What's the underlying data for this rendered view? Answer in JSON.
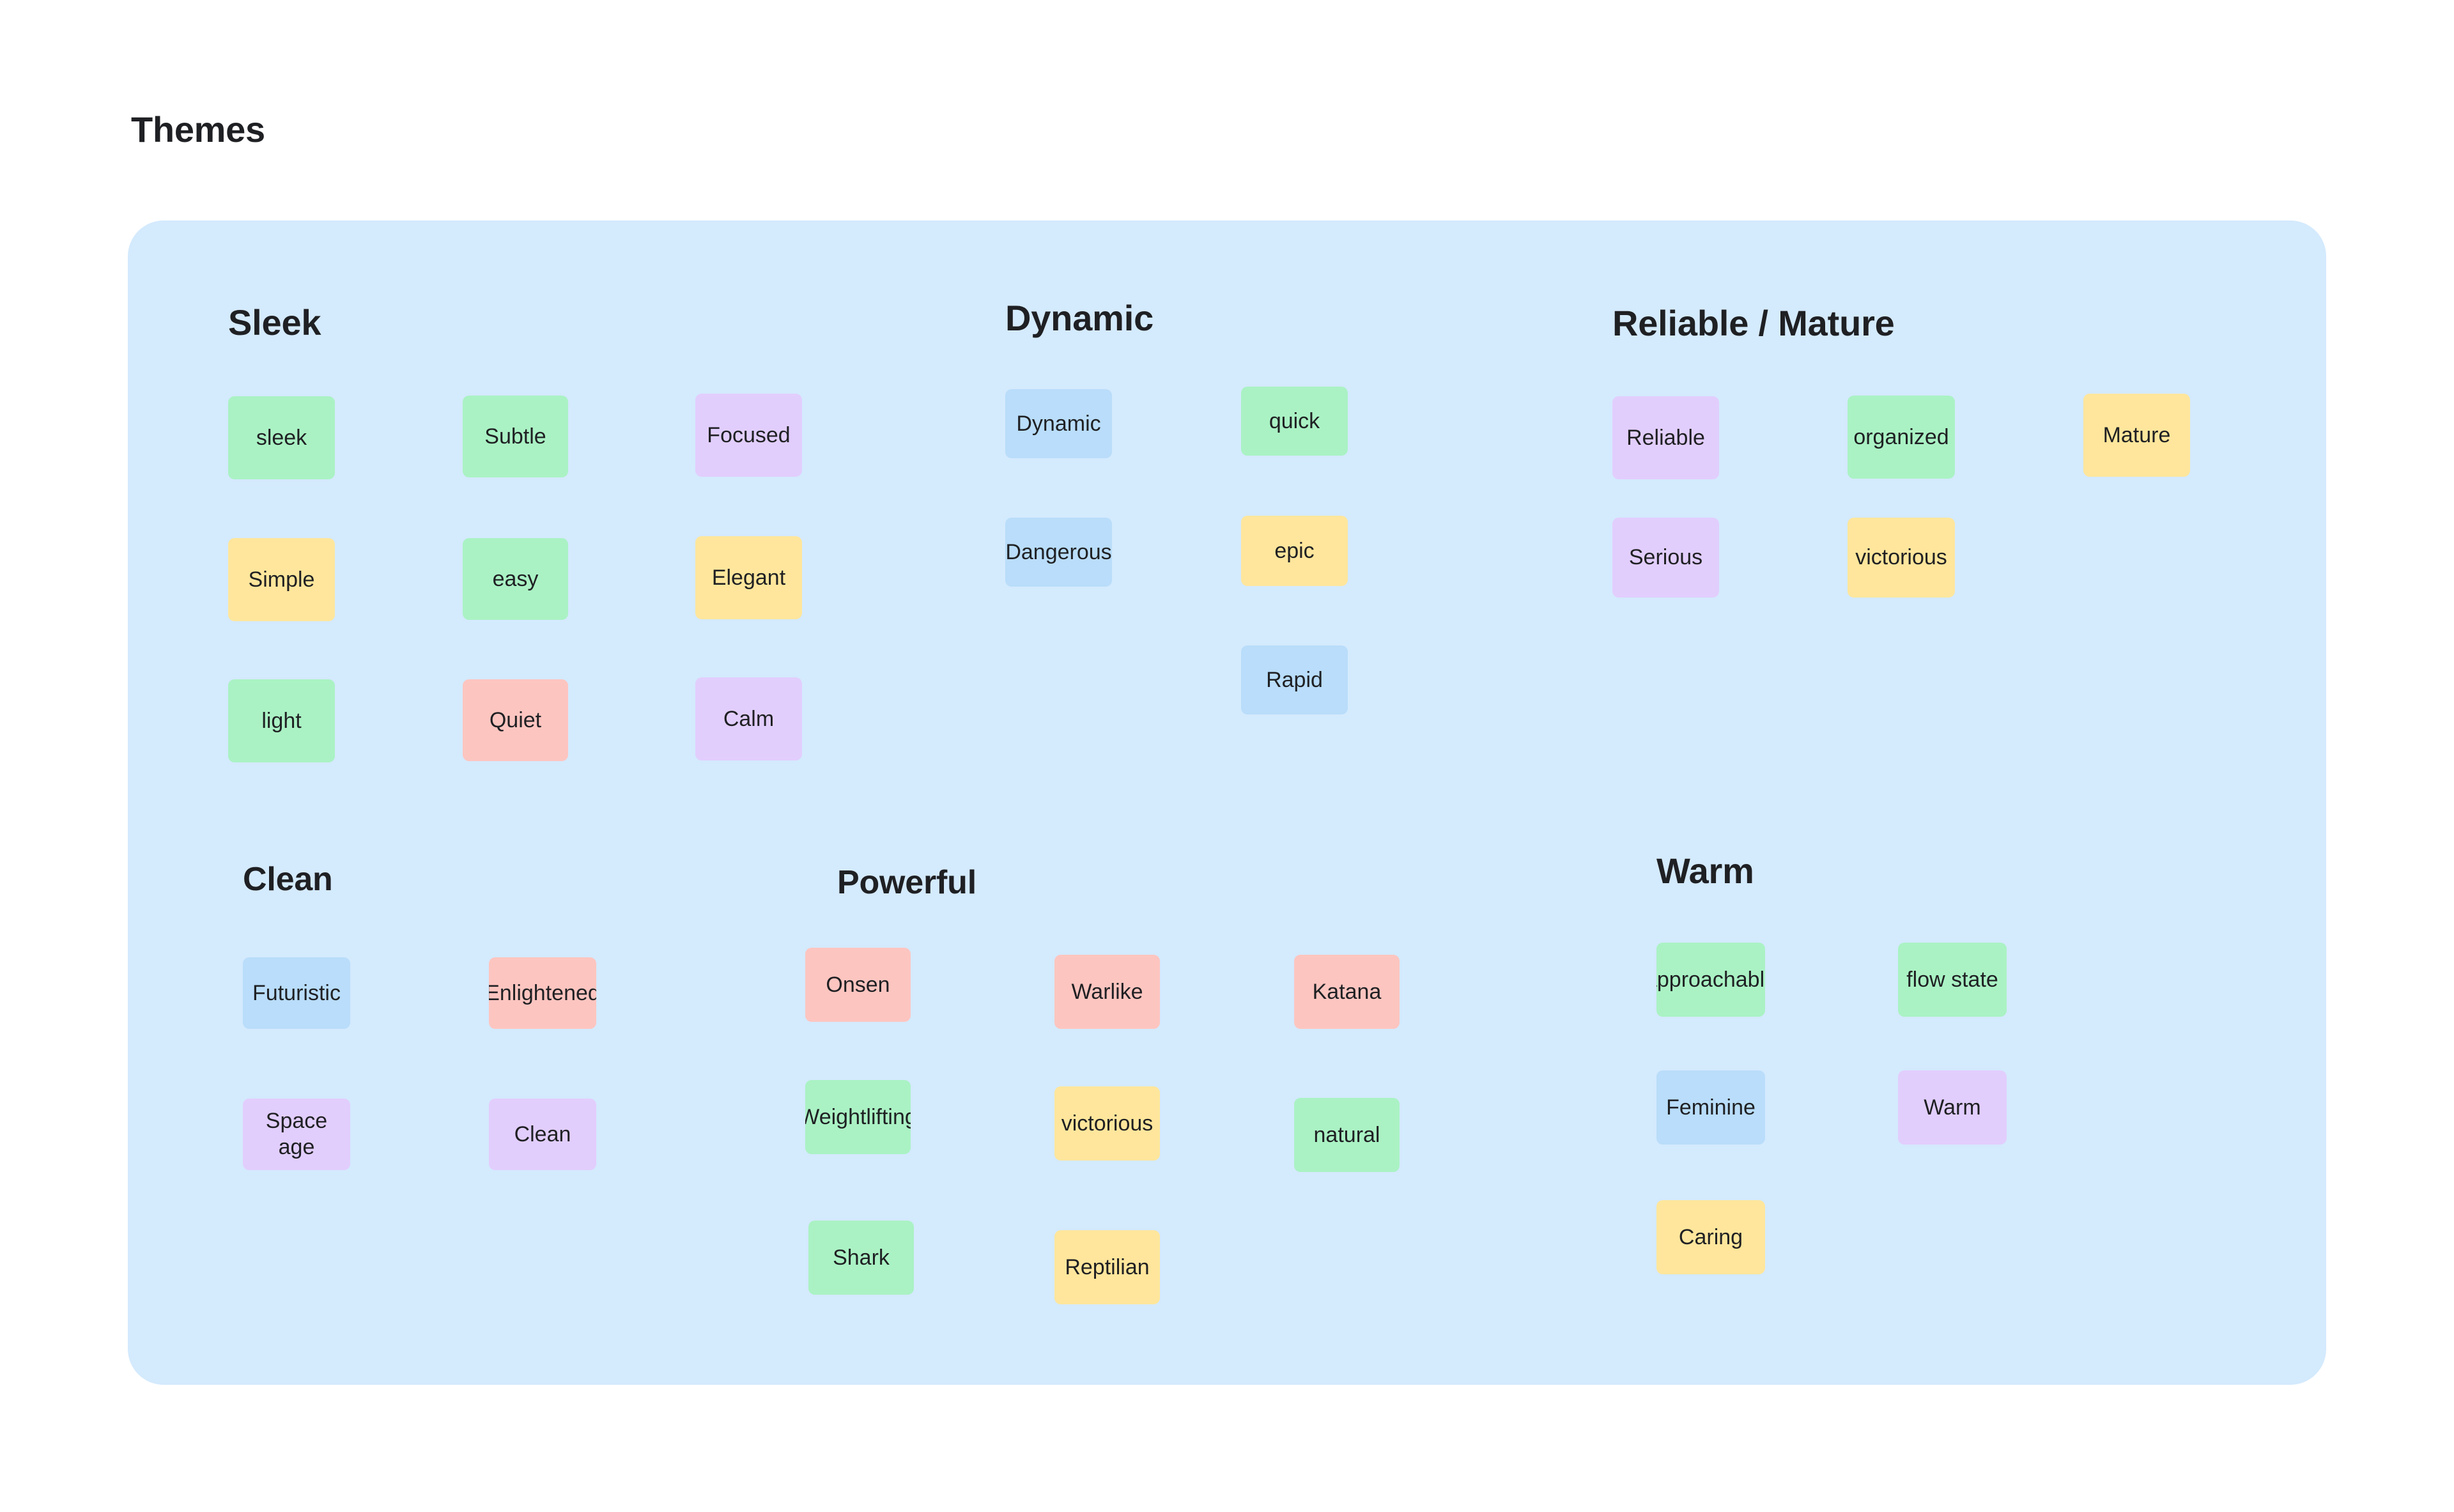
{
  "page": {
    "title": "Themes",
    "background": "#ffffff",
    "board_background": "#d4eafd"
  },
  "palette": {
    "green": "#aaf2c4",
    "yellow": "#ffe69c",
    "purple": "#e2cefd",
    "pink": "#fdc5c0",
    "blue": "#b9ddfa",
    "text": "#1f2023"
  },
  "groups": [
    {
      "id": "sleek",
      "title": "Sleek",
      "notes": [
        {
          "label": "sleek",
          "color": "green"
        },
        {
          "label": "Subtle",
          "color": "green"
        },
        {
          "label": "Focused",
          "color": "purple"
        },
        {
          "label": "Simple",
          "color": "yellow"
        },
        {
          "label": "easy",
          "color": "green"
        },
        {
          "label": "Elegant",
          "color": "yellow"
        },
        {
          "label": "light",
          "color": "green"
        },
        {
          "label": "Quiet",
          "color": "pink"
        },
        {
          "label": "Calm",
          "color": "purple"
        }
      ]
    },
    {
      "id": "dynamic",
      "title": "Dynamic",
      "notes": [
        {
          "label": "Dynamic",
          "color": "blue"
        },
        {
          "label": "quick",
          "color": "green"
        },
        {
          "label": "Dangerous",
          "color": "blue"
        },
        {
          "label": "epic",
          "color": "yellow"
        },
        {
          "label": "Rapid",
          "color": "blue"
        }
      ]
    },
    {
      "id": "reliable-mature",
      "title": "Reliable / Mature",
      "notes": [
        {
          "label": "Reliable",
          "color": "purple"
        },
        {
          "label": "organized",
          "color": "green"
        },
        {
          "label": "Mature",
          "color": "yellow"
        },
        {
          "label": "Serious",
          "color": "purple"
        },
        {
          "label": "victorious",
          "color": "yellow"
        }
      ]
    },
    {
      "id": "clean",
      "title": "Clean",
      "notes": [
        {
          "label": "Futuristic",
          "color": "blue"
        },
        {
          "label": "Enlightened",
          "color": "pink"
        },
        {
          "label": "Space age",
          "color": "purple"
        },
        {
          "label": "Clean",
          "color": "purple"
        }
      ]
    },
    {
      "id": "powerful",
      "title": "Powerful",
      "notes": [
        {
          "label": "Weightlifting",
          "color": "green"
        },
        {
          "label": "Onsen",
          "color": "pink"
        },
        {
          "label": "Warlike",
          "color": "pink"
        },
        {
          "label": "Katana",
          "color": "pink"
        },
        {
          "label": "victorious",
          "color": "yellow"
        },
        {
          "label": "natural",
          "color": "green"
        },
        {
          "label": "Shark",
          "color": "green"
        },
        {
          "label": "Reptilian",
          "color": "yellow"
        }
      ]
    },
    {
      "id": "warm",
      "title": "Warm",
      "notes": [
        {
          "label": "approachable",
          "color": "green"
        },
        {
          "label": "flow state",
          "color": "green"
        },
        {
          "label": "Feminine",
          "color": "blue"
        },
        {
          "label": "Warm",
          "color": "purple"
        },
        {
          "label": "Caring",
          "color": "yellow"
        }
      ]
    }
  ]
}
